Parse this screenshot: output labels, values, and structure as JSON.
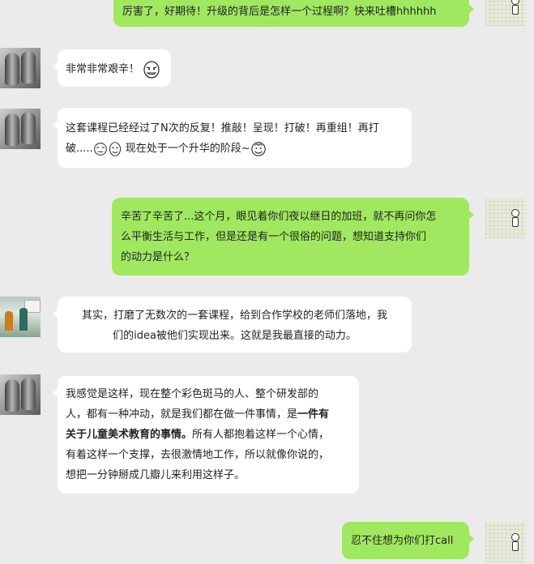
{
  "messages": [
    {
      "side": "right",
      "avatar": "kid-sketch-avatar",
      "text": "厉害了，好期待！升级的背后是怎样一个过程啊？快来吐槽hhhhhh"
    },
    {
      "side": "left",
      "avatar": "gray-figures-avatar",
      "text": "非常非常艰辛！",
      "emoji": "rage-face-icon"
    },
    {
      "side": "left",
      "avatar": "gray-figures-avatar",
      "line1": "这套课程已经经过了N次的反复！推敲！呈现！打破！再重组！再打",
      "line2_pre": "破.....",
      "line2_post": " 现在处于一个升华的阶段~",
      "emojis": [
        "rage-face-icon",
        "rage-face-icon",
        "rage-face-icon"
      ]
    },
    {
      "side": "right",
      "avatar": "kid-sketch-avatar",
      "text": "辛苦了辛苦了...这个月，眼见着你们夜以继日的加班，就不再问你怎\n么平衡生活与工作，但是还是有一个很俗的问题，想知道支持你们\n的动力是什么？"
    },
    {
      "side": "left",
      "avatar": "classroom-photo-avatar",
      "text": "其实，打磨了无数次的一套课程，给到合作学校的老师们落地，我\n们的idea被他们实现出来。这就是我最直接的动力。"
    },
    {
      "side": "left",
      "avatar": "gray-figures-avatar",
      "line1": "我感觉是这样，现在整个彩色斑马的人、整个研发部的",
      "line2_pre": "人，都有一种冲动，就是我们都在做一件事情，是",
      "line2_bold": "一件有",
      "line3_bold": "关于儿童美术教育的事情。",
      "line3_post": "所有人都抱着这样一个心情，",
      "line4": "有着这样一个支撑，去很激情地工作，所以就像你说的，",
      "line5": "想把一分钟掰成几瓣儿来利用这样子。"
    },
    {
      "side": "right",
      "avatar": "kid-sketch-avatar",
      "text": "忍不住想为你们打call"
    }
  ]
}
